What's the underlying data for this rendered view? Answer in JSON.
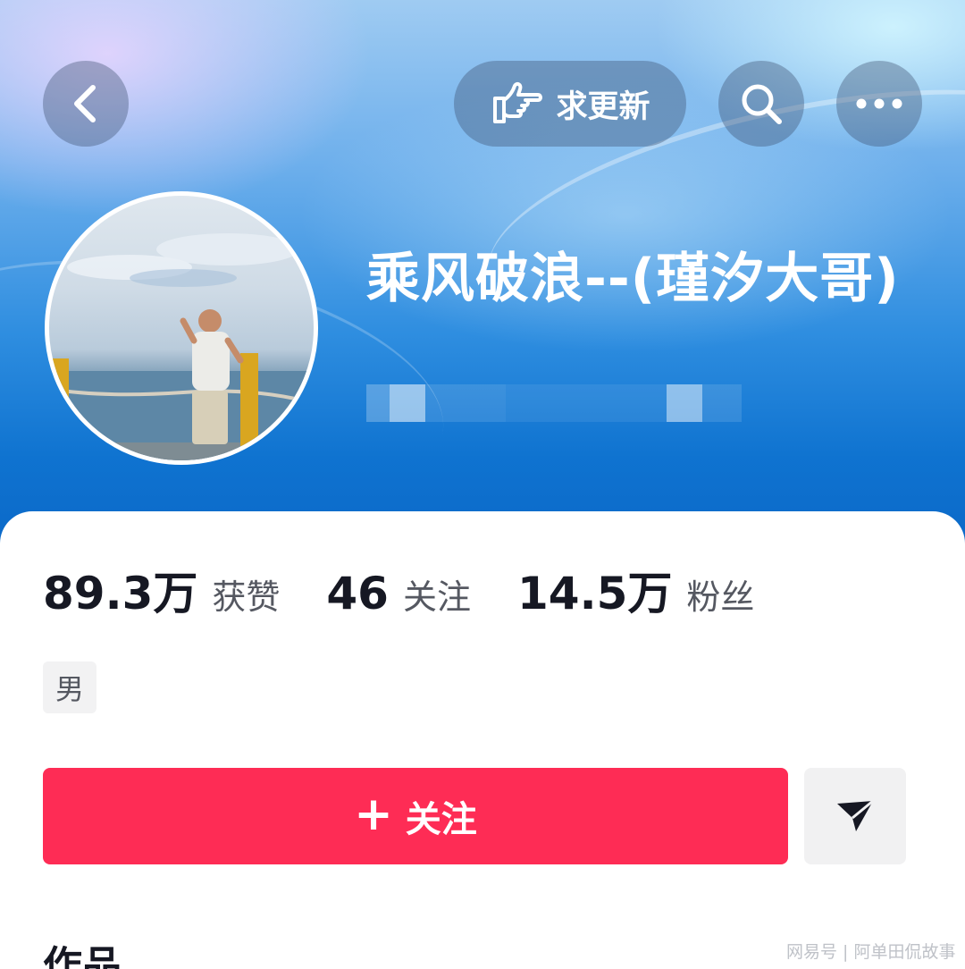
{
  "header": {
    "request_update_label": "求更新",
    "icons": {
      "back": "chevron-left-icon",
      "request": "pointing-hand-icon",
      "search": "search-icon",
      "more": "more-dots-icon"
    }
  },
  "profile": {
    "name": "乘风破浪--(瑾汐大哥)",
    "gender": "男"
  },
  "stats": [
    {
      "value": "89.3万",
      "label": "获赞"
    },
    {
      "value": "46",
      "label": "关注"
    },
    {
      "value": "14.5万",
      "label": "粉丝"
    }
  ],
  "actions": {
    "follow_plus": "+",
    "follow_label": "关注"
  },
  "sections": {
    "works_label": "作品"
  },
  "watermark": "网易号 | 阿单田侃故事",
  "colors": {
    "follow_button": "#fe2c55",
    "primary_text": "#161823",
    "secondary_text": "#555861"
  }
}
